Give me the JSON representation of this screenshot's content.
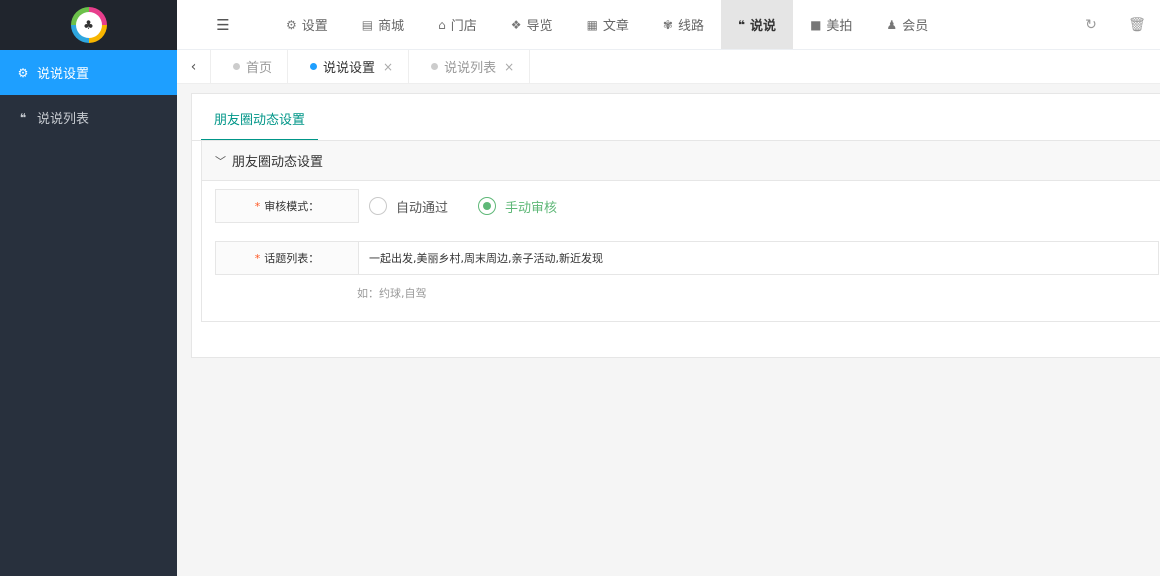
{
  "sidebar": {
    "logo": {
      "icon": "logo-badge",
      "glyph": "♣"
    },
    "items": [
      {
        "label": "说说设置",
        "icon": "gears-icon",
        "glyph": "⚙",
        "active": true
      },
      {
        "label": "说说列表",
        "icon": "wechat-icon",
        "glyph": "❝",
        "active": false
      }
    ]
  },
  "topbar": {
    "toggle_glyph": "☰",
    "nav": [
      {
        "label": "设置",
        "icon": "gears-icon",
        "glyph": "⚙",
        "active": false
      },
      {
        "label": "商城",
        "icon": "bag-icon",
        "glyph": "▤",
        "active": false
      },
      {
        "label": "门店",
        "icon": "bank-icon",
        "glyph": "⌂",
        "active": false
      },
      {
        "label": "导览",
        "icon": "cubes-icon",
        "glyph": "❖",
        "active": false
      },
      {
        "label": "文章",
        "icon": "newspaper-icon",
        "glyph": "▦",
        "active": false
      },
      {
        "label": "线路",
        "icon": "wheat-icon",
        "glyph": "✾",
        "active": false
      },
      {
        "label": "说说",
        "icon": "wechat-icon",
        "glyph": "❝",
        "active": true
      },
      {
        "label": "美拍",
        "icon": "video-camera-icon",
        "glyph": "■",
        "active": false
      },
      {
        "label": "会员",
        "icon": "user-icon",
        "glyph": "♟",
        "active": false
      }
    ],
    "right": [
      {
        "icon": "refresh-icon",
        "glyph": "↻"
      },
      {
        "icon": "trash-icon",
        "glyph": "🗑"
      }
    ]
  },
  "tabstrip": {
    "back_glyph": "‹",
    "tabs": [
      {
        "label": "首页",
        "active": false,
        "closable": false
      },
      {
        "label": "说说设置",
        "active": true,
        "closable": true
      },
      {
        "label": "说说列表",
        "active": false,
        "closable": true
      }
    ],
    "close_glyph": "×"
  },
  "panel": {
    "tab_label": "朋友圈动态设置",
    "section_title": "朋友圈动态设置",
    "chevron_glyph": "﹀",
    "review_mode": {
      "label": "审核模式：",
      "required_mark": "*",
      "options": [
        {
          "label": "自动通过",
          "checked": false
        },
        {
          "label": "手动审核",
          "checked": true
        }
      ]
    },
    "topics": {
      "label": "话题列表：",
      "required_mark": "*",
      "value": "一起出发,美丽乡村,周末周边,亲子活动,新近发现",
      "hint": "如：约球,自驾"
    }
  },
  "colors": {
    "sidebar_bg": "#28303d",
    "sidebar_active": "#1e9fff",
    "accent_green": "#009688",
    "radio_checked": "#5fb878",
    "required": "#ff5722"
  }
}
